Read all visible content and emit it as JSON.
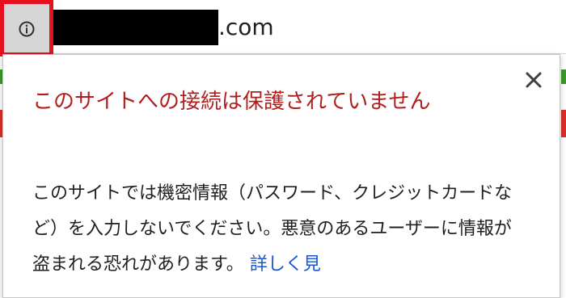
{
  "address_bar": {
    "url_visible": ".com",
    "info_icon": "info-circle-icon"
  },
  "popup": {
    "heading": "このサイトへの接続は保護されていません",
    "body": "このサイトでは機密情報（パスワード、クレジットカードなど）を入力しないでください。悪意のあるユーザーに情報が盗まれる恐れがあります。",
    "learn_more": "詳しく見",
    "close_icon": "close-icon"
  },
  "colors": {
    "highlight": "#e8101f",
    "warning_text": "#b01e1e",
    "link": "#1a56c8"
  }
}
